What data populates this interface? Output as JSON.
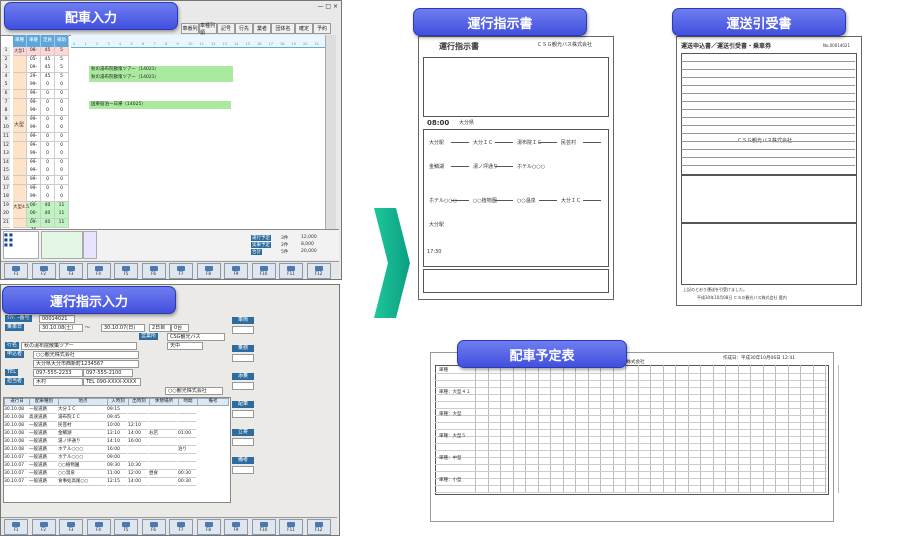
{
  "titles": {
    "haisha_input": "配車入力",
    "unko_input": "運行指示入力",
    "unko_doc": "運行指示書",
    "soso_doc": "運送引受書",
    "haisha_plan": "配車予定表"
  },
  "screen1": {
    "toolbar": [
      "車番列",
      "車種列順",
      "記号",
      "行先",
      "業者",
      "団体名",
      "確定",
      "予約"
    ],
    "grid_header": [
      "車種",
      "車番",
      "定員",
      "補助"
    ],
    "types": [
      "大型",
      "大型4.5"
    ],
    "rows": [
      {
        "no": "1",
        "bus": "大型1",
        "code": "08-07",
        "cap": "45",
        "sub": "5"
      },
      {
        "no": "2",
        "bus": "",
        "code": "05-07",
        "cap": "45",
        "sub": "5"
      },
      {
        "no": "3",
        "bus": "",
        "code": "09-07",
        "cap": "45",
        "sub": "5"
      },
      {
        "no": "4",
        "bus": "",
        "code": "29-56",
        "cap": "45",
        "sub": "5"
      },
      {
        "no": "5",
        "bus": "",
        "code": "99-11",
        "cap": "0",
        "sub": "0"
      },
      {
        "no": "6",
        "bus": "",
        "code": "99-12",
        "cap": "0",
        "sub": "0"
      },
      {
        "no": "7",
        "bus": "",
        "code": "99-13",
        "cap": "0",
        "sub": "0"
      },
      {
        "no": "8",
        "bus": "",
        "code": "99-21",
        "cap": "0",
        "sub": "0"
      },
      {
        "no": "9",
        "bus": "",
        "code": "99-22",
        "cap": "0",
        "sub": "0"
      },
      {
        "no": "10",
        "bus": "",
        "code": "99-23",
        "cap": "0",
        "sub": "0"
      },
      {
        "no": "11",
        "bus": "",
        "code": "99-24",
        "cap": "0",
        "sub": "0"
      },
      {
        "no": "12",
        "bus": "",
        "code": "99-31",
        "cap": "0",
        "sub": "0"
      },
      {
        "no": "13",
        "bus": "",
        "code": "99-32",
        "cap": "0",
        "sub": "0"
      },
      {
        "no": "14",
        "bus": "",
        "code": "99-33",
        "cap": "0",
        "sub": "0"
      },
      {
        "no": "15",
        "bus": "",
        "code": "99-41",
        "cap": "0",
        "sub": "0"
      },
      {
        "no": "16",
        "bus": "",
        "code": "99-42",
        "cap": "0",
        "sub": "0"
      },
      {
        "no": "17",
        "bus": "",
        "code": "99-43",
        "cap": "0",
        "sub": "0"
      },
      {
        "no": "18",
        "bus": "",
        "code": "99-44",
        "cap": "0",
        "sub": "0"
      },
      {
        "no": "19",
        "bus": "大型4.5",
        "code": "00-16",
        "cap": "40",
        "sub": "11"
      },
      {
        "no": "20",
        "bus": "",
        "code": "00-74",
        "cap": "40",
        "sub": "11"
      },
      {
        "no": "21",
        "bus": "",
        "code": "09-76",
        "cap": "40",
        "sub": "11"
      }
    ],
    "bars": [
      {
        "text": "秋の湯布院散策ツアー（14021）"
      },
      {
        "text": "秋の湯布院散策ツアー（14021）"
      },
      {
        "text": "国東宿泊ー日帰（14025）"
      }
    ],
    "summary": {
      "h1": "運行予定",
      "h2": "実車予定",
      "h3": "合計",
      "r1": "12,000",
      "r2": "8,000",
      "r3": "20,000",
      "a1": "3件",
      "a2": "2件",
      "a3": "5件"
    },
    "fkeys": [
      "F1",
      "F2",
      "F3",
      "F4",
      "F5",
      "F6",
      "F7",
      "F8",
      "F9",
      "F10",
      "F11",
      "F12"
    ]
  },
  "screen2": {
    "order_no": "00014021",
    "date_from": "30.10.08(土)",
    "date_to": "30.10.07(日)",
    "days": "2日目",
    "count": "0台",
    "tour_name": "秋の湯布院散策ツアー",
    "office": "CSG観光バス",
    "dept": "天中",
    "client": "○○観光株式会社",
    "address": "大分県大分市西新町1234567",
    "tel": "097-555-2233",
    "fax": "097-555-2100",
    "contact": "TEL 090-XXXX-XXXX",
    "person": "木村",
    "plan_hdr": [
      "運行日",
      "配車種別",
      "地点",
      "入時刻",
      "出時刻",
      "休憩場所",
      "時間",
      "備考"
    ],
    "plan_rows": [
      {
        "d": "30.10.08",
        "k": "一般道路",
        "p": "大分ＩＣ",
        "a": "09:15",
        "b": "",
        "r": "",
        "t": ""
      },
      {
        "d": "30.10.08",
        "k": "高速道路",
        "p": "湯布院ＩＣ",
        "a": "09:45",
        "b": "",
        "r": "",
        "t": ""
      },
      {
        "d": "30.10.08",
        "k": "一般道路",
        "p": "民芸村",
        "a": "10:00",
        "b": "12:10",
        "r": "",
        "t": ""
      },
      {
        "d": "30.10.08",
        "k": "一般道路",
        "p": "金鱗湖",
        "a": "12:10",
        "b": "14:00",
        "r": "お店",
        "t": "01:00"
      },
      {
        "d": "30.10.08",
        "k": "一般道路",
        "p": "湯ノ坪通り",
        "a": "14:10",
        "b": "16:00",
        "r": "",
        "t": ""
      },
      {
        "d": "30.10.08",
        "k": "一般道路",
        "p": "ホテル○○○",
        "a": "16:00",
        "b": "",
        "r": "",
        "t": "泊り"
      },
      {
        "d": "30.10.07",
        "k": "一般道路",
        "p": "ホテル○○○",
        "a": "09:00",
        "b": "",
        "r": "",
        "t": ""
      },
      {
        "d": "30.10.07",
        "k": "一般道路",
        "p": "○○植物園",
        "a": "09:30",
        "b": "10:30",
        "r": "",
        "t": ""
      },
      {
        "d": "30.10.07",
        "k": "一般道路",
        "p": "○○温泉",
        "a": "11:00",
        "b": "12:00",
        "r": "昼食",
        "t": "00:30"
      },
      {
        "d": "30.10.07",
        "k": "一般道路",
        "p": "食事処高尾○○",
        "a": "12:15",
        "b": "14:00",
        "r": "",
        "t": "00:30"
      }
    ],
    "side_heads": [
      "車両",
      "乗務",
      "添乗",
      "配車",
      "立寄",
      "備考"
    ],
    "fkeys": [
      "F1",
      "F2",
      "F3",
      "F4",
      "F5",
      "F6",
      "F7",
      "F8",
      "F9",
      "F10",
      "F11",
      "F12"
    ]
  },
  "doc_unko": {
    "head": "運行指示書",
    "company": "ＣＳＧ観光バス株式会社",
    "place": "大分県",
    "route": [
      "大分駅",
      "大分ＩＣ",
      "湯布院ＩＣ",
      "民芸村",
      "金鱗湖",
      "湯ノ坪通り",
      "ホテル○○○"
    ],
    "route2": [
      "ホテル○○○",
      "○○植物園",
      "○○温泉",
      "大分ＩＣ",
      "大分駅"
    ],
    "start": "08:00",
    "end": "17:30"
  },
  "doc_soso": {
    "head": "運送申込書／運送引受書・乗車券",
    "company": "ＣＳＧ観光バス株式会社",
    "no": "No.00014021",
    "date": "上記のとおり運送を引受けました。",
    "footer": "平成30年10月08日  ＣＳＧ観光バス株式会社  鹿内"
  },
  "doc_plan": {
    "head": "配車予定表",
    "office": "営業所：CSG観光バス株式会社",
    "printed": "作成日：平成30年10月06日 12:41",
    "labels": [
      "車種",
      "車種：大型４１",
      "車種：大型",
      "車種：大型５",
      "車種：中型",
      "車種：小型"
    ]
  }
}
